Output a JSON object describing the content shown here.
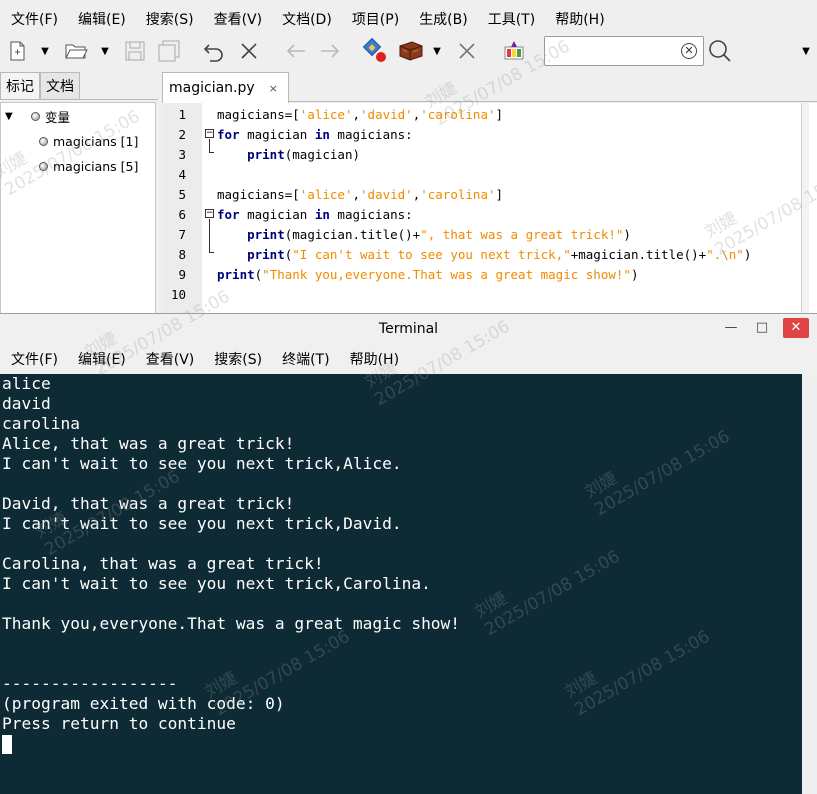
{
  "geany": {
    "menu": [
      "文件(F)",
      "编辑(E)",
      "搜索(S)",
      "查看(V)",
      "文档(D)",
      "项目(P)",
      "生成(B)",
      "工具(T)",
      "帮助(H)"
    ],
    "sidebar": {
      "tabs": [
        "标记",
        "文档"
      ],
      "tree": {
        "root": "变量",
        "items": [
          "magicians [1]",
          "magicians [5]"
        ]
      }
    },
    "editor": {
      "tab_label": "magician.py",
      "close_glyph": "×",
      "line_numbers": [
        "1",
        "2",
        "3",
        "4",
        "5",
        "6",
        "7",
        "8",
        "9",
        "10"
      ]
    }
  },
  "terminal": {
    "title": "Terminal",
    "controls": {
      "minimize": "—",
      "maximize": "□",
      "close": "✕"
    },
    "menu": [
      "文件(F)",
      "编辑(E)",
      "查看(V)",
      "搜索(S)",
      "终端(T)",
      "帮助(H)"
    ],
    "output": [
      "alice",
      "david",
      "carolina",
      "Alice, that was a great trick!",
      "I can't wait to see you next trick,Alice.",
      "",
      "David, that was a great trick!",
      "I can't wait to see you next trick,David.",
      "",
      "Carolina, that was a great trick!",
      "I can't wait to see you next trick,Carolina.",
      "",
      "Thank you,everyone.That was a great magic show!",
      "",
      "",
      "------------------",
      "(program exited with code: 0)",
      "Press return to continue"
    ]
  },
  "watermark": {
    "name": "刘婕",
    "datetime": "2025/07/08 15:06"
  },
  "colors": {
    "keyword": "#00007f",
    "string": "#f08a00",
    "terminal_bg": "#0d2a35"
  }
}
